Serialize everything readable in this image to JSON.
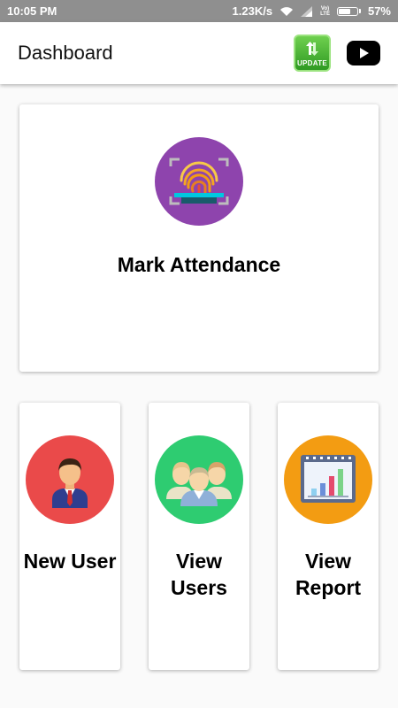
{
  "status_bar": {
    "time": "10:05 PM",
    "network_speed": "1.23K/s",
    "lte_top": "Vo)",
    "lte_bottom": "LTE",
    "battery": "57%",
    "battery_level": 0.57
  },
  "app_bar": {
    "title": "Dashboard",
    "update_label": "UPDATE",
    "update_icon": "update-arrows-icon",
    "youtube_icon": "youtube-play-icon"
  },
  "cards": {
    "mark_attendance": {
      "label": "Mark Attendance",
      "icon": "fingerprint-scan-icon",
      "color": "#8e44ad"
    },
    "new_user": {
      "label_line1": "New User",
      "icon": "user-avatar-icon",
      "color": "#ea4a4a"
    },
    "view_users": {
      "label_line1": "View",
      "label_line2": "Users",
      "icon": "users-group-icon",
      "color": "#2ecc71"
    },
    "view_report": {
      "label_line1": "View",
      "label_line2": "Report",
      "icon": "bar-chart-report-icon",
      "color": "#f39c12"
    }
  }
}
